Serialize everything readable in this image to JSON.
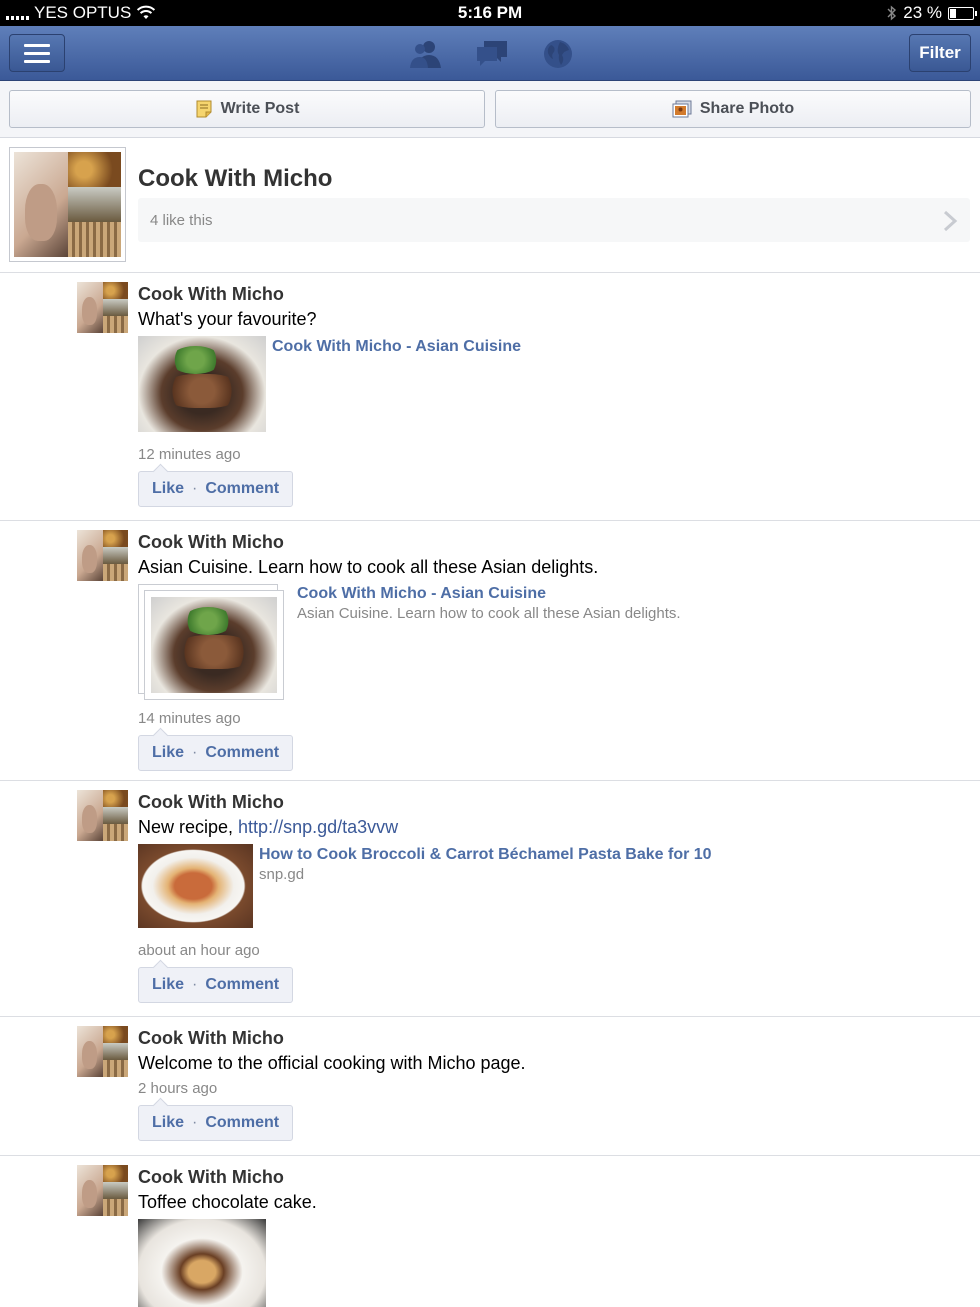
{
  "status_bar": {
    "carrier": "YES OPTUS",
    "time": "5:16 PM",
    "battery": "23 %",
    "battery_level": 0.23
  },
  "navbar": {
    "filter_label": "Filter",
    "icons": [
      "friends-icon",
      "messages-icon",
      "notifications-globe-icon"
    ]
  },
  "composer": {
    "write_post_label": "Write Post",
    "share_photo_label": "Share Photo"
  },
  "page": {
    "title": "Cook With Micho",
    "likes": "4 like this"
  },
  "actions": {
    "like": "Like",
    "separator": "·",
    "comment": "Comment"
  },
  "posts": [
    {
      "author": "Cook With Micho",
      "message": "What's your favourite?",
      "attachment_title": "Cook With Micho - Asian Cuisine",
      "time": "12 minutes ago"
    },
    {
      "author": "Cook With Micho",
      "message": "Asian Cuisine. Learn how to cook all these Asian delights.",
      "attachment_title": "Cook With Micho - Asian Cuisine",
      "attachment_desc": "Asian Cuisine. Learn how to cook all these Asian delights.",
      "time": "14 minutes ago"
    },
    {
      "author": "Cook With Micho",
      "message_prefix": "New recipe, ",
      "message_link": "http://snp.gd/ta3vvw",
      "attachment_title": "How to Cook Broccoli & Carrot Béchamel Pasta Bake for 10",
      "attachment_desc": "snp.gd",
      "time": "about an hour ago"
    },
    {
      "author": "Cook With Micho",
      "message": "Welcome to the official cooking with Micho page.",
      "time": "2 hours ago"
    },
    {
      "author": "Cook With Micho",
      "message": "Toffee chocolate cake."
    }
  ]
}
